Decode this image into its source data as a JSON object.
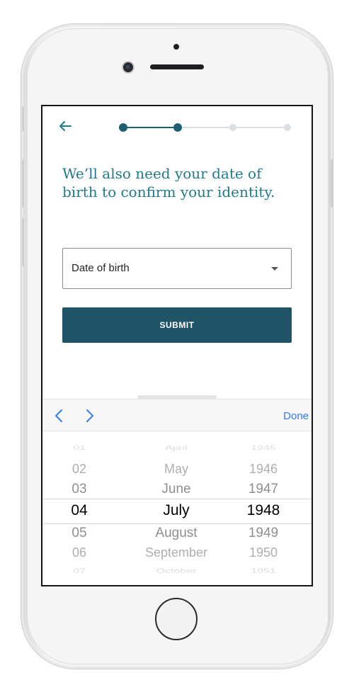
{
  "colors": {
    "accent": "#1f7a8c",
    "button_bg": "#1f5566",
    "ios_blue": "#2f7bf6",
    "progress_active": "#1f5f72",
    "progress_inactive": "#d9dfe2"
  },
  "header": {
    "back_icon": "arrow-left-icon",
    "progress": {
      "total_steps": 4,
      "current_step": 2
    }
  },
  "main": {
    "headline": "We’ll also need your date of birth to confirm your identity.",
    "dob_field": {
      "label": "Date of birth",
      "icon": "caret-down-icon"
    },
    "submit_label": "SUBMIT"
  },
  "picker": {
    "toolbar": {
      "prev_icon": "chevron-left-icon",
      "next_icon": "chevron-right-icon",
      "done_label": "Done"
    },
    "columns": [
      {
        "name": "day",
        "rows": [
          "01",
          "02",
          "03",
          "04",
          "05",
          "06",
          "07"
        ],
        "selected_index": 3
      },
      {
        "name": "month",
        "rows": [
          "April",
          "May",
          "June",
          "July",
          "August",
          "September",
          "October"
        ],
        "selected_index": 3
      },
      {
        "name": "year",
        "rows": [
          "1945",
          "1946",
          "1947",
          "1948",
          "1949",
          "1950",
          "1951"
        ],
        "selected_index": 3
      }
    ]
  }
}
